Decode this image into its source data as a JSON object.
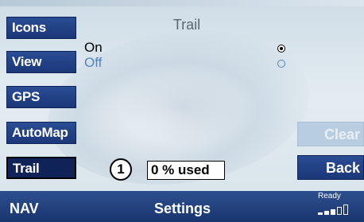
{
  "sidebar": {
    "items": [
      {
        "label": "Icons",
        "active": false
      },
      {
        "label": "View",
        "active": false
      },
      {
        "label": "GPS",
        "active": false
      },
      {
        "label": "AutoMap",
        "active": false
      },
      {
        "label": "Trail",
        "active": true
      }
    ]
  },
  "panel": {
    "title": "Trail",
    "options": [
      {
        "label": "On",
        "selected": true
      },
      {
        "label": "Off",
        "selected": false
      }
    ]
  },
  "buttons": {
    "clear_label": "Clear",
    "back_label": "Back"
  },
  "usage": {
    "callout_number": "1",
    "text": "0 % used"
  },
  "statusbar": {
    "left_label": "NAV",
    "center_label": "Settings",
    "ready_label": "Ready",
    "signal_bars_filled": 3,
    "signal_bars_total": 5
  },
  "colors": {
    "accent": "#1b3778",
    "selected_option": "#000000",
    "unselected_option": "#4f86c6",
    "disabled_button": "#b9cde0"
  },
  "icons": {
    "radio_on": "radio-selected-icon",
    "radio_off": "radio-unselected-icon",
    "signal": "signal-strength-icon"
  }
}
